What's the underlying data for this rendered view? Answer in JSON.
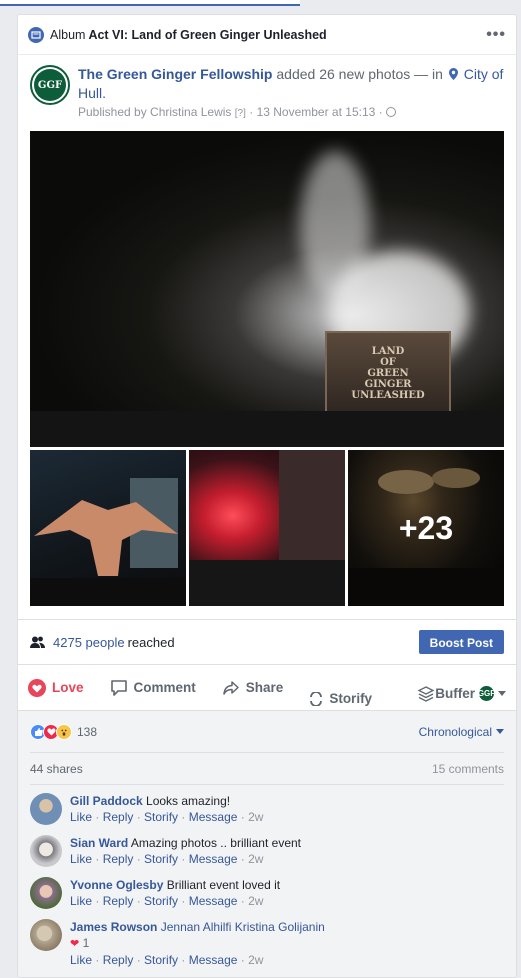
{
  "album": {
    "prefix": "Album",
    "title": "Act VI: Land of Green Ginger Unleashed",
    "more_icon": "more-dots-icon"
  },
  "post": {
    "page_name": "The Green Ginger Fellowship",
    "action_text": "added 26 new photos — in",
    "location": "City of Hull.",
    "published_by": "Published by Christina Lewis",
    "help_marker": "[?]",
    "timestamp": "· 13 November at 15:13 ·",
    "logo_text": "GGF"
  },
  "photos": {
    "sign_lines": [
      "LAND",
      "OF",
      "GREEN",
      "GINGER",
      "UNLEASHED"
    ],
    "more_count": "+23"
  },
  "reach": {
    "count": "4275 people",
    "suffix": "reached",
    "boost_label": "Boost Post"
  },
  "actions": {
    "love": "Love",
    "comment": "Comment",
    "share": "Share",
    "storify": "Storify",
    "buffer": "Buffer"
  },
  "reactions": {
    "count": "138",
    "sort_label": "Chronological",
    "shares": "44 shares",
    "comments": "15 comments"
  },
  "comment_action_labels": {
    "like": "Like",
    "reply": "Reply",
    "storify": "Storify",
    "message": "Message"
  },
  "comments": [
    {
      "author": "Gill Paddock",
      "text": "Looks amazing!",
      "time": "2w",
      "avatar_color": "#6f8fb5"
    },
    {
      "author": "Sian Ward",
      "text": "Amazing photos .. brilliant event",
      "time": "2w",
      "avatar_color": "#c9c9cc"
    },
    {
      "author": "Yvonne Oglesby",
      "text": "Brilliant event loved it",
      "time": "2w",
      "avatar_color": "#8c6e8c"
    },
    {
      "author": "James Rowson",
      "text": "Jennan Alhilfi Kristina Golijanin",
      "time": "2w",
      "avatar_color": "#b3a58e",
      "reactions": "1"
    }
  ],
  "colors": {
    "facebook_blue": "#4267b2",
    "link": "#365899",
    "love": "#e9445a",
    "brand_green": "#0d5c3a"
  }
}
